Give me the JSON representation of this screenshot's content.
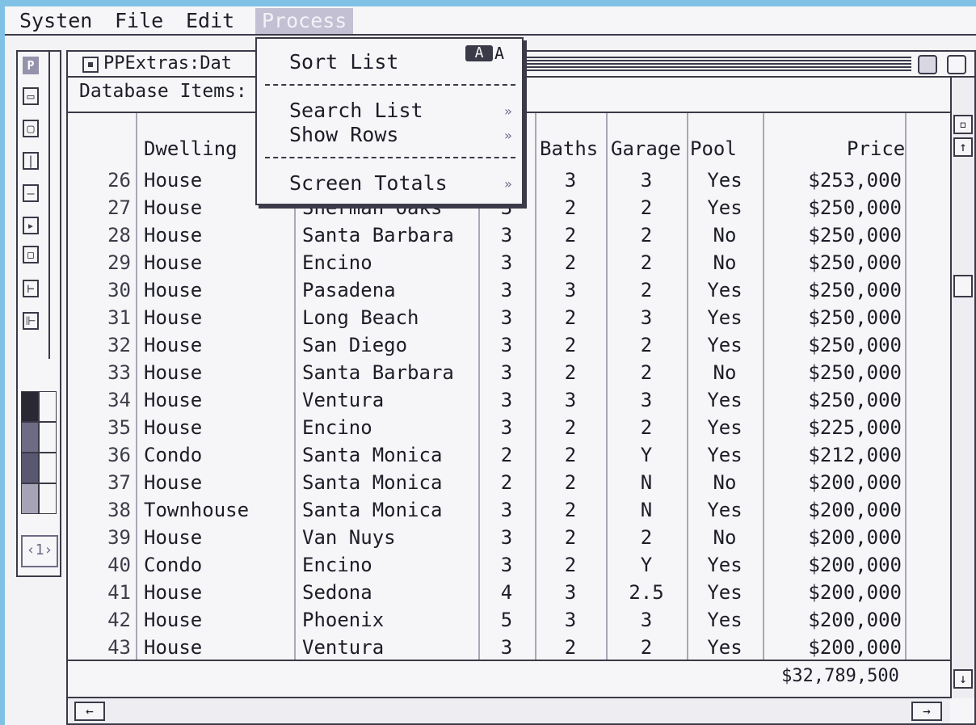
{
  "menubar": {
    "items": [
      "Systen",
      "File",
      "Edit",
      "Process"
    ],
    "active": "Process"
  },
  "palette": {
    "logo": "P",
    "page_indicator": "‹1›"
  },
  "window": {
    "title": "PPExtras:Dat",
    "subheader": "Database Items:"
  },
  "dropdown": {
    "sort": "Sort List",
    "sort_shortcut_key": "A",
    "sort_shortcut_letter": "A",
    "search": "Search List",
    "show": "Show Rows",
    "totals": "Screen Totals",
    "submenu_glyph": "»"
  },
  "table": {
    "headers": {
      "dwelling": "Dwelling",
      "baths": "Baths",
      "garage": "Garage",
      "pool": "Pool",
      "price": "Price"
    },
    "rows": [
      {
        "num": "26",
        "dwelling": "House",
        "location": "",
        "beds": "",
        "baths": "3",
        "garage": "3",
        "pool": "Yes",
        "price": "$253,000"
      },
      {
        "num": "27",
        "dwelling": "House",
        "location": "Sherman Oaks",
        "beds": "3",
        "baths": "2",
        "garage": "2",
        "pool": "Yes",
        "price": "$250,000"
      },
      {
        "num": "28",
        "dwelling": "House",
        "location": "Santa Barbara",
        "beds": "3",
        "baths": "2",
        "garage": "2",
        "pool": "No",
        "price": "$250,000"
      },
      {
        "num": "29",
        "dwelling": "House",
        "location": "Encino",
        "beds": "3",
        "baths": "2",
        "garage": "2",
        "pool": "No",
        "price": "$250,000"
      },
      {
        "num": "30",
        "dwelling": "House",
        "location": "Pasadena",
        "beds": "3",
        "baths": "3",
        "garage": "2",
        "pool": "Yes",
        "price": "$250,000"
      },
      {
        "num": "31",
        "dwelling": "House",
        "location": "Long Beach",
        "beds": "3",
        "baths": "2",
        "garage": "3",
        "pool": "Yes",
        "price": "$250,000"
      },
      {
        "num": "32",
        "dwelling": "House",
        "location": "San Diego",
        "beds": "3",
        "baths": "2",
        "garage": "2",
        "pool": "Yes",
        "price": "$250,000"
      },
      {
        "num": "33",
        "dwelling": "House",
        "location": "Santa Barbara",
        "beds": "3",
        "baths": "2",
        "garage": "2",
        "pool": "No",
        "price": "$250,000"
      },
      {
        "num": "34",
        "dwelling": "House",
        "location": "Ventura",
        "beds": "3",
        "baths": "3",
        "garage": "3",
        "pool": "Yes",
        "price": "$250,000"
      },
      {
        "num": "35",
        "dwelling": "House",
        "location": "Encino",
        "beds": "3",
        "baths": "2",
        "garage": "2",
        "pool": "Yes",
        "price": "$225,000"
      },
      {
        "num": "36",
        "dwelling": "Condo",
        "location": "Santa Monica",
        "beds": "2",
        "baths": "2",
        "garage": "Y",
        "pool": "Yes",
        "price": "$212,000"
      },
      {
        "num": "37",
        "dwelling": "House",
        "location": "Santa Monica",
        "beds": "2",
        "baths": "2",
        "garage": "N",
        "pool": "No",
        "price": "$200,000"
      },
      {
        "num": "38",
        "dwelling": "Townhouse",
        "location": "Santa Monica",
        "beds": "3",
        "baths": "2",
        "garage": "N",
        "pool": "Yes",
        "price": "$200,000"
      },
      {
        "num": "39",
        "dwelling": "House",
        "location": "Van Nuys",
        "beds": "3",
        "baths": "2",
        "garage": "2",
        "pool": "No",
        "price": "$200,000"
      },
      {
        "num": "40",
        "dwelling": "Condo",
        "location": "Encino",
        "beds": "3",
        "baths": "2",
        "garage": "Y",
        "pool": "Yes",
        "price": "$200,000"
      },
      {
        "num": "41",
        "dwelling": "House",
        "location": "Sedona",
        "beds": "4",
        "baths": "3",
        "garage": "2.5",
        "pool": "Yes",
        "price": "$200,000"
      },
      {
        "num": "42",
        "dwelling": "House",
        "location": "Phoenix",
        "beds": "5",
        "baths": "3",
        "garage": "3",
        "pool": "Yes",
        "price": "$200,000"
      },
      {
        "num": "43",
        "dwelling": "House",
        "location": "Ventura",
        "beds": "3",
        "baths": "2",
        "garage": "2",
        "pool": "Yes",
        "price": "$200,000"
      }
    ],
    "total": "$32,789,500"
  },
  "icons": {
    "up": "↑",
    "down": "↓",
    "left": "←",
    "right": "→"
  }
}
